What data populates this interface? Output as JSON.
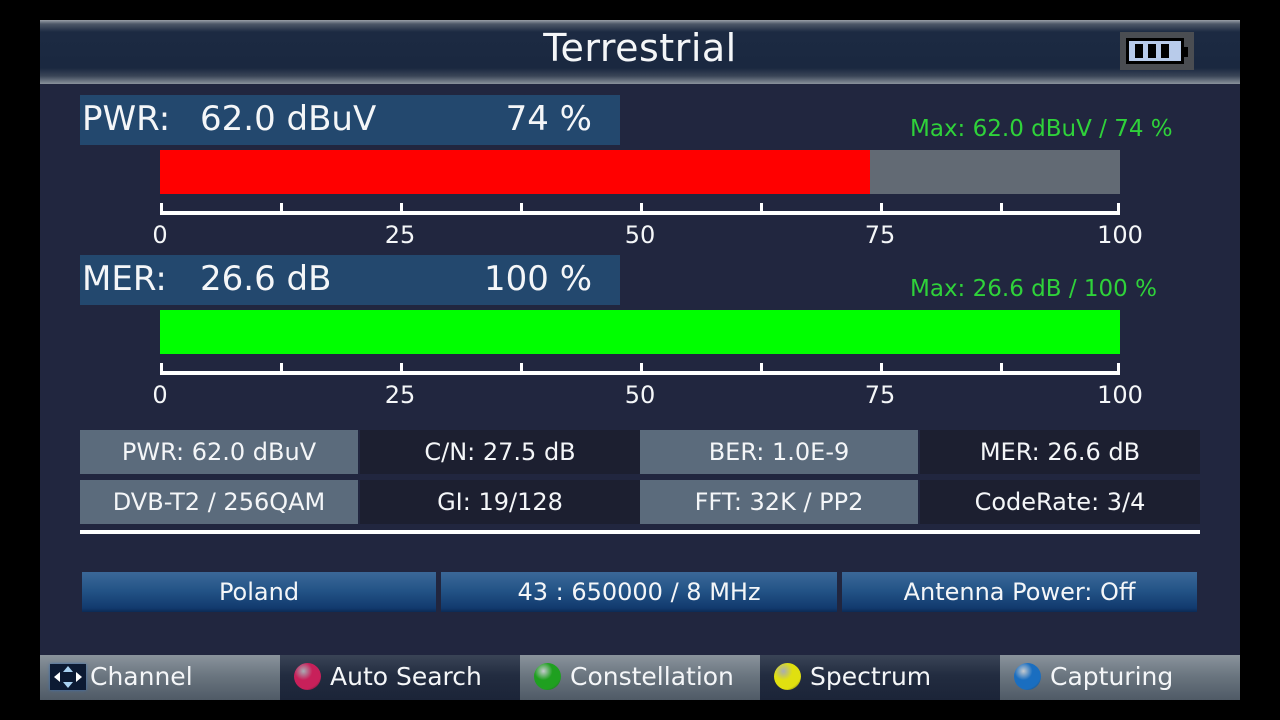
{
  "header": {
    "title": "Terrestrial",
    "battery_icon": "battery-icon",
    "battery_level_cells": 3
  },
  "meters": {
    "pwr": {
      "name": "PWR:",
      "value": "62.0 dBuV",
      "percent_label": "74 %",
      "percent": 74,
      "max": "Max: 62.0 dBuV / 74 %",
      "color": "#ff0000",
      "scale": [
        "0",
        "25",
        "50",
        "75",
        "100"
      ]
    },
    "mer": {
      "name": "MER:",
      "value": "26.6 dB",
      "percent_label": "100 %",
      "percent": 100,
      "max": "Max: 26.6 dB  / 100 %",
      "color": "#00ff00",
      "scale": [
        "0",
        "25",
        "50",
        "75",
        "100"
      ]
    }
  },
  "params": {
    "row1": [
      "PWR: 62.0 dBuV",
      "C/N: 27.5 dB",
      "BER: 1.0E-9",
      "MER: 26.6 dB"
    ],
    "row2": [
      "DVB-T2 / 256QAM",
      "GI: 19/128",
      "FFT: 32K / PP2",
      "CodeRate: 3/4"
    ]
  },
  "info": {
    "region": "Poland",
    "channel": "43 : 650000 / 8 MHz",
    "antenna": "Antenna Power: Off"
  },
  "footer": [
    {
      "label": "Channel",
      "icon": "arrow-keys-icon"
    },
    {
      "label": "Auto Search",
      "icon": "red-button-icon",
      "color": "#c8205a"
    },
    {
      "label": "Constellation",
      "icon": "green-button-icon",
      "color": "#1fa020"
    },
    {
      "label": "Spectrum",
      "icon": "yellow-button-icon",
      "color": "#e0e010"
    },
    {
      "label": "Capturing",
      "icon": "blue-button-icon",
      "color": "#1a6ec0"
    }
  ]
}
